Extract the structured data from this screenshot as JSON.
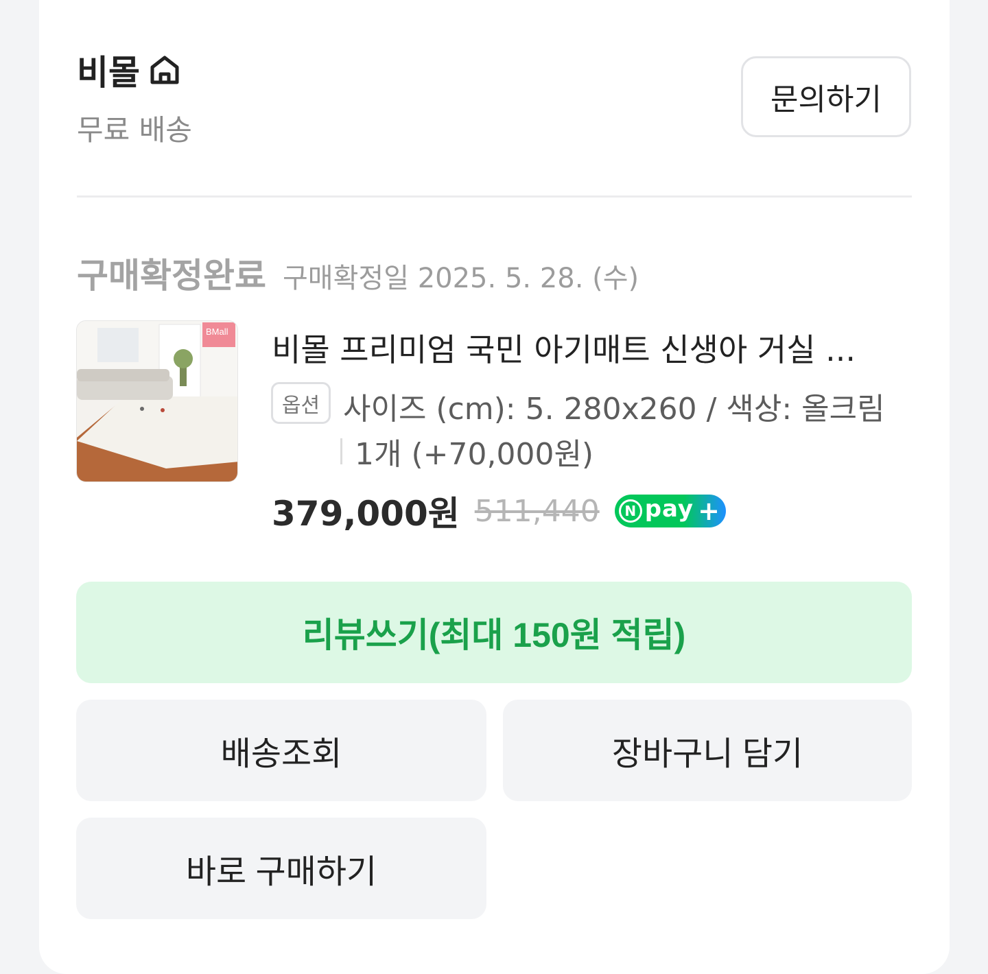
{
  "shop": {
    "name": "비몰",
    "shipping": "무료 배송",
    "inquiry_label": "문의하기"
  },
  "order": {
    "status": "구매확정완료",
    "confirm_date": "구매확정일 2025. 5. 28. (수)"
  },
  "product": {
    "thumbnail_brand": "BMall",
    "name": "비몰 프리미엄 국민 아기매트 신생아 거실 ...",
    "option_badge": "옵션",
    "option_text": "사이즈 (cm): 5. 280x260 / 색상: 올크림",
    "quantity_text": "1개 (+70,000원)",
    "price": "379,000원",
    "original_price": "511,440",
    "pay_badge": {
      "n": "N",
      "pay": "pay",
      "plus": "+"
    }
  },
  "actions": {
    "review": "리뷰쓰기(최대 150원 적립)",
    "tracking": "배송조회",
    "add_to_cart": "장바구니 담기",
    "buy_now": "바로 구매하기"
  },
  "colors": {
    "background": "#f3f4f6",
    "card": "#ffffff",
    "review_bg": "#ddf8e5",
    "review_text": "#1aa14b",
    "npay_green": "#03c75a",
    "npay_blue": "#1e90ff"
  }
}
